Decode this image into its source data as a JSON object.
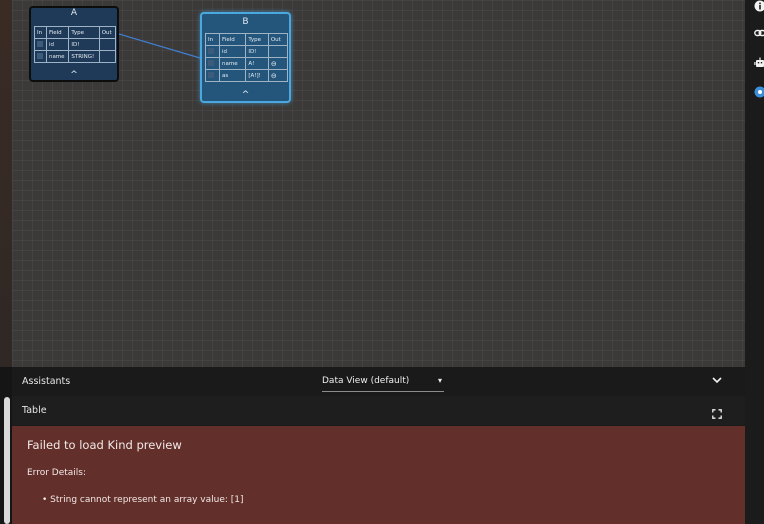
{
  "graph": {
    "nodes": [
      {
        "title": "A",
        "headers": [
          "In",
          "Field",
          "Type",
          "Out"
        ],
        "rows": [
          {
            "field": "id",
            "type": "ID!",
            "out": ""
          },
          {
            "field": "name",
            "type": "STRING!",
            "out": ""
          }
        ]
      },
      {
        "title": "B",
        "headers": [
          "In",
          "Field",
          "Type",
          "Out"
        ],
        "rows": [
          {
            "field": "id",
            "type": "ID!",
            "out": ""
          },
          {
            "field": "name",
            "type": "A!",
            "out": "⊖"
          },
          {
            "field": "as",
            "type": "[A!]!",
            "out": "⊖"
          }
        ]
      }
    ],
    "collapse_caret": "^"
  },
  "rail": {
    "icons": [
      "info-icon",
      "link-icon",
      "robot-icon",
      "status-dot-icon"
    ],
    "accent": "#3b8fd8"
  },
  "panel": {
    "assistants_label": "Assistants",
    "view_select": "Data View (default)",
    "view_select_arrow": "▾",
    "collapse_icon": "⌄",
    "table_label": "Table",
    "error": {
      "title": "Failed to load Kind preview",
      "details_label": "Error Details:",
      "messages": [
        "String cannot represent an array value: [1]"
      ]
    },
    "error_color": "#632f2a"
  }
}
